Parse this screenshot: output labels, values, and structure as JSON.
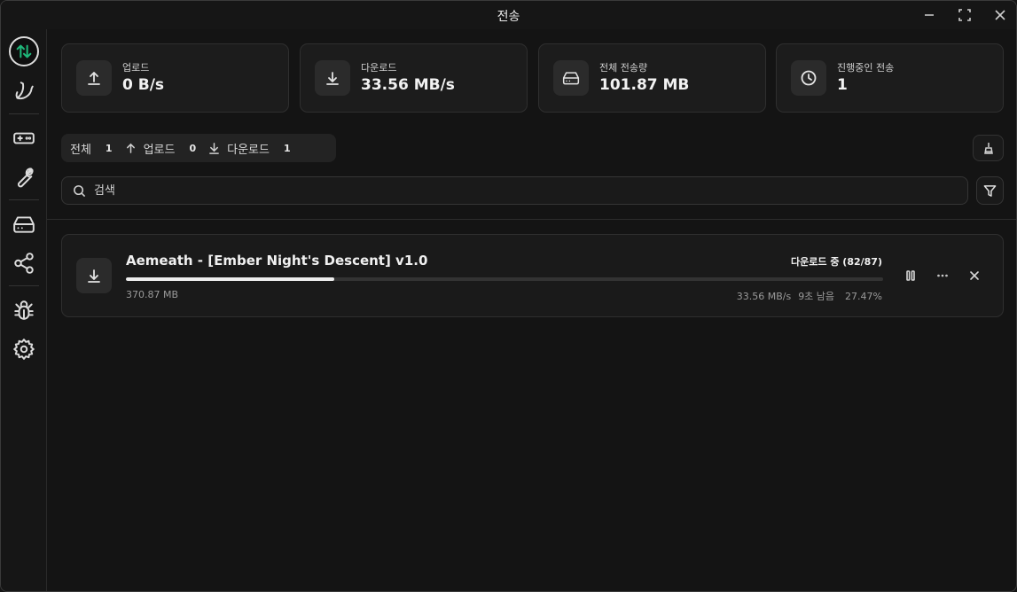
{
  "window": {
    "title": "전송"
  },
  "stats": [
    {
      "label": "업로드",
      "value": "0 B/s",
      "icon": "upload-icon"
    },
    {
      "label": "다운로드",
      "value": "33.56 MB/s",
      "icon": "download-icon"
    },
    {
      "label": "전체 전송량",
      "value": "101.87 MB",
      "icon": "drive-icon"
    },
    {
      "label": "진행중인 전송",
      "value": "1",
      "icon": "clock-icon"
    }
  ],
  "filters": [
    {
      "label": "전체",
      "count": "1"
    },
    {
      "label": "업로드",
      "count": "0"
    },
    {
      "label": "다운로드",
      "count": "1"
    }
  ],
  "search": {
    "placeholder": "검색"
  },
  "transfers": [
    {
      "name": "Aemeath - [Ember Night's Descent] v1.0",
      "status": "다운로드 중 (82/87)",
      "size": "370.87 MB",
      "speed": "33.56 MB/s",
      "remaining": "9초 남음",
      "percent": "27.47%",
      "progress": 0.2747
    }
  ],
  "sidebar": {
    "items": [
      "transfer-icon",
      "banana-icon",
      "gamepad-icon",
      "wrench-icon",
      "drive-icon",
      "share-icon",
      "bug-icon",
      "settings-icon"
    ]
  },
  "colors": {
    "accent": "#1fb87a",
    "background": "#141414",
    "card": "#1c1c1c"
  }
}
